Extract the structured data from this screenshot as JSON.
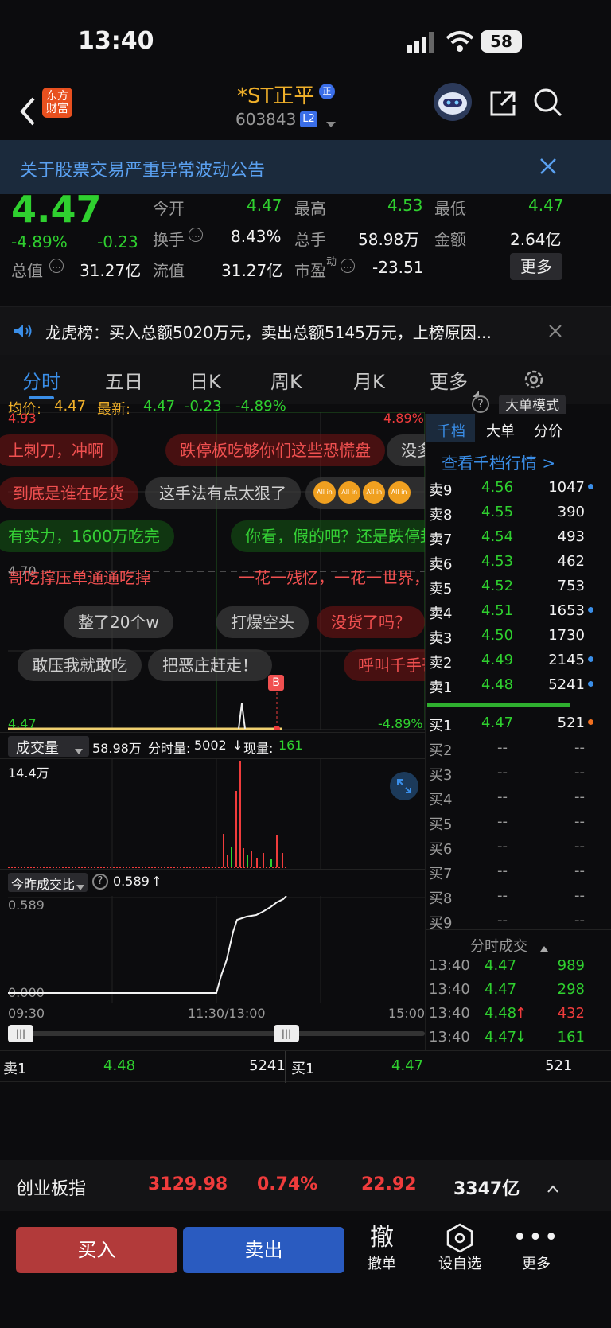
{
  "status": {
    "time": "13:40",
    "battery": "58"
  },
  "header": {
    "logo_line1": "东方",
    "logo_line2": "财富",
    "title": "*ST正平",
    "title_badge": "正",
    "code": "603843",
    "level": "L2"
  },
  "banner": {
    "text": "关于股票交易严重异常波动公告"
  },
  "quote": {
    "price": "4.47",
    "change_pct": "-4.89%",
    "change": "-0.23",
    "labels": [
      "今开",
      "最高",
      "最低",
      "换手",
      "总手",
      "金额",
      "总值",
      "流值",
      "市盈"
    ],
    "jinkai": "4.47",
    "zuigao": "4.53",
    "zuidi": "4.47",
    "huanshou": "8.43%",
    "zongshou": "58.98万",
    "jine": "2.64亿",
    "zongzhi": "31.27亿",
    "liuzhi": "31.27亿",
    "shiying": "-23.51",
    "shiying_sup": "动",
    "more": "更多"
  },
  "notice": {
    "text": "龙虎榜：买入总额5020万元，卖出总额5145万元，上榜原因..."
  },
  "tabs": [
    "分时",
    "五日",
    "日K",
    "周K",
    "月K",
    "更多"
  ],
  "chart_info": {
    "avg_label": "均价:",
    "avg": "4.47",
    "latest_label": "最新:",
    "latest": "4.47",
    "chg": "-0.23",
    "pct": "-4.89%",
    "big_mode": "大单模式"
  },
  "chart_axis": {
    "top_price": "4.93",
    "top_pct": "4.89%",
    "mid_price": "4.70",
    "bottom_price": "4.47",
    "bottom_pct": "-4.89%"
  },
  "danmu": [
    "上刺刀，冲啊",
    "跌停板吃够你们这些恐慌盘",
    "没多",
    "到底是谁在吃货",
    "这手法有点太狠了",
    "有实力，1600万吃完",
    "你看，假的吧？还是跌停封",
    "哥吃撑压单通通吃掉",
    "一花一残忆，一花一世界，",
    "整了20个w",
    "打爆空头",
    "没货了吗？",
    "敢压我就敢吃",
    "把恶庄赶走！",
    "呼叫千手哥"
  ],
  "allin": "All in",
  "volume": {
    "selector": "成交量",
    "total": "58.98万",
    "fenshi_label": "分时量:",
    "fenshi": "5002",
    "xian_label": "现量:",
    "xian": "161",
    "max": "14.4万"
  },
  "ratio": {
    "selector": "今昨成交比",
    "value": "0.589",
    "top": "0.589",
    "bottom": "0.000"
  },
  "time_axis": [
    "09:30",
    "11:30/13:00",
    "15:00"
  ],
  "right_tabs": [
    "千档",
    "大单",
    "分价"
  ],
  "right_link": "查看千档行情 >",
  "sells": [
    {
      "label": "卖9",
      "price": "4.56",
      "vol": "1047",
      "dot": true
    },
    {
      "label": "卖8",
      "price": "4.55",
      "vol": "390",
      "dot": false
    },
    {
      "label": "卖7",
      "price": "4.54",
      "vol": "493",
      "dot": false
    },
    {
      "label": "卖6",
      "price": "4.53",
      "vol": "462",
      "dot": false
    },
    {
      "label": "卖5",
      "price": "4.52",
      "vol": "753",
      "dot": false
    },
    {
      "label": "卖4",
      "price": "4.51",
      "vol": "1653",
      "dot": true
    },
    {
      "label": "卖3",
      "price": "4.50",
      "vol": "1730",
      "dot": false
    },
    {
      "label": "卖2",
      "price": "4.49",
      "vol": "2145",
      "dot": true
    },
    {
      "label": "卖1",
      "price": "4.48",
      "vol": "5241",
      "dot": true
    }
  ],
  "buys": [
    {
      "label": "买1",
      "price": "4.47",
      "vol": "521"
    },
    {
      "label": "买2",
      "price": "--",
      "vol": "--"
    },
    {
      "label": "买3",
      "price": "--",
      "vol": "--"
    },
    {
      "label": "买4",
      "price": "--",
      "vol": "--"
    },
    {
      "label": "买5",
      "price": "--",
      "vol": "--"
    },
    {
      "label": "买6",
      "price": "--",
      "vol": "--"
    },
    {
      "label": "买7",
      "price": "--",
      "vol": "--"
    },
    {
      "label": "买8",
      "price": "--",
      "vol": "--"
    },
    {
      "label": "买9",
      "price": "--",
      "vol": "--"
    }
  ],
  "ticks_title": "分时成交",
  "ticks": [
    {
      "time": "13:40",
      "price": "4.47",
      "vol": "989",
      "color": "green",
      "arrow": ""
    },
    {
      "time": "13:40",
      "price": "4.47",
      "vol": "298",
      "color": "green",
      "arrow": ""
    },
    {
      "time": "13:40",
      "price": "4.48",
      "vol": "432",
      "color": "red",
      "arrow": "↑"
    },
    {
      "time": "13:40",
      "price": "4.47",
      "vol": "161",
      "color": "green",
      "arrow": "↓"
    }
  ],
  "bidask": {
    "sell_label": "卖1",
    "sell_price": "4.48",
    "sell_vol": "5241",
    "buy_label": "买1",
    "buy_price": "4.47",
    "buy_vol": "521"
  },
  "index": {
    "name": "创业板指",
    "value": "3129.98",
    "pct": "0.74%",
    "chg": "22.92",
    "amount": "3347亿"
  },
  "bottom": {
    "buy": "买入",
    "sell": "卖出",
    "cancel_icon": "撤",
    "cancel": "撤单",
    "watch": "设自选",
    "more": "更多"
  },
  "colors": {
    "up": "#f03c3c",
    "down": "#2fd02f",
    "buy_button": "#b23a3a",
    "sell_button": "#2a5bc0",
    "accent": "#3a8ee8"
  },
  "chart_data": {
    "type": "line",
    "title": "",
    "x": [
      "09:30",
      "11:30/13:00",
      "13:40"
    ],
    "series": [
      {
        "name": "今昨成交比",
        "values": [
          0.0,
          0.0,
          0.589
        ]
      }
    ],
    "ylim": [
      0,
      0.589
    ]
  }
}
